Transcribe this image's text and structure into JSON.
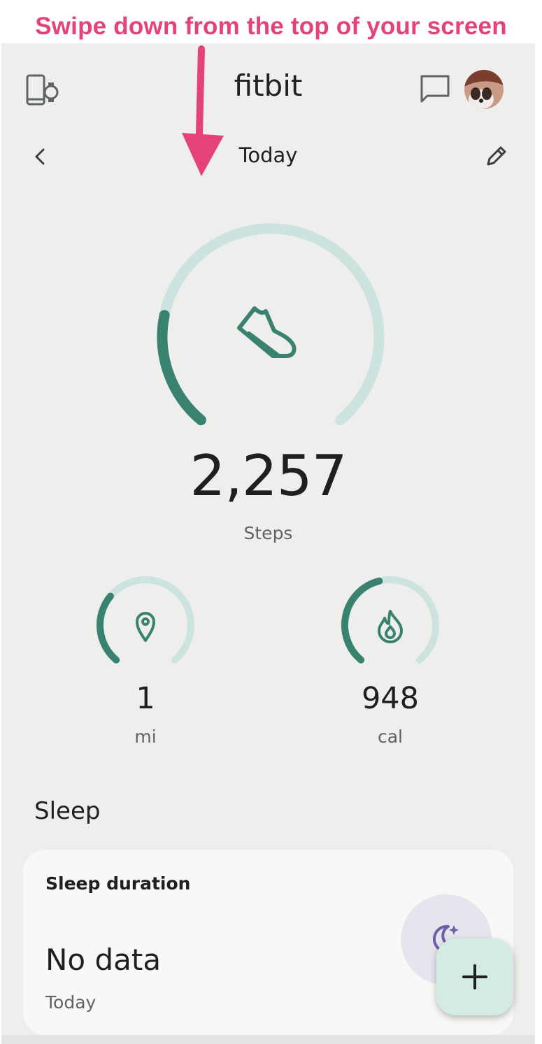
{
  "annotation": {
    "text": "Swipe down from the top of your screen",
    "color": "#e5427a"
  },
  "header": {
    "device_icon": "phone-watch-icon",
    "app_title": "fitbit",
    "message_icon": "message-icon",
    "avatar_icon": "avatar"
  },
  "date_bar": {
    "back_icon": "chevron-left-icon",
    "label": "Today",
    "edit_icon": "pencil-icon"
  },
  "steps": {
    "value": "2,257",
    "label": "Steps",
    "progress": 0.22,
    "icon": "shoe-icon"
  },
  "metrics": [
    {
      "value": "1",
      "unit": "mi",
      "progress": 0.32,
      "icon": "location-pin-icon"
    },
    {
      "value": "948",
      "unit": "cal",
      "progress": 0.45,
      "icon": "flame-icon"
    }
  ],
  "sleep": {
    "section_title": "Sleep",
    "card_title": "Sleep duration",
    "value": "No data",
    "sub": "Today",
    "icon": "moon-stars-icon"
  },
  "fab": {
    "icon": "plus-icon"
  },
  "colors": {
    "accent": "#3a8270",
    "ring_track": "#cde3df",
    "screen_bg": "#eeefec",
    "card_bg": "#f8f9f6",
    "fab_bg": "#d4ebe3"
  }
}
